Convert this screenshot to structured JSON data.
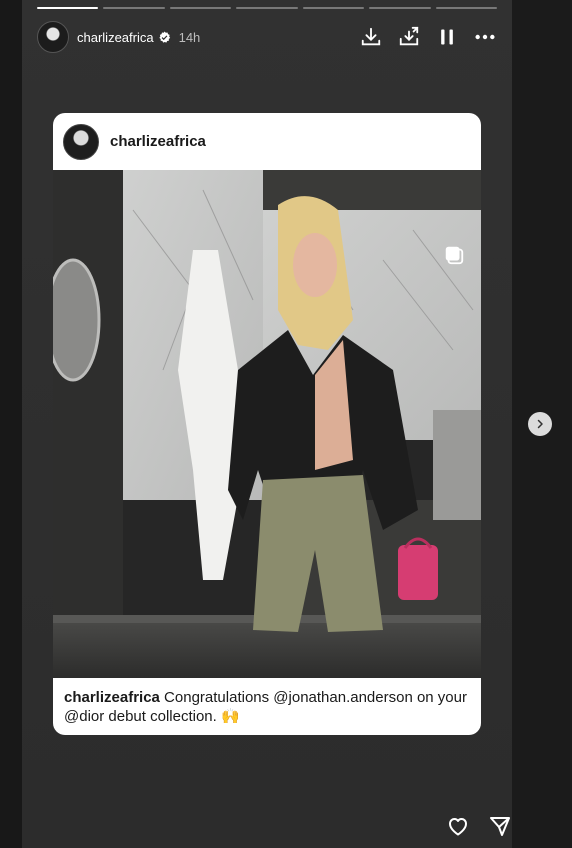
{
  "story": {
    "progress_segments": 7,
    "active_segment": 0,
    "header": {
      "username": "charlizeafrica",
      "verified": true,
      "timestamp": "14h"
    },
    "header_icons": [
      "download-icon",
      "save-to-device-icon",
      "pause-icon",
      "more-options-icon"
    ]
  },
  "card": {
    "username": "charlizeafrica",
    "caption_user": "charlizeafrica",
    "caption_text": " Congratulations @jonathan.anderson on your @dior debut collection. 🙌"
  },
  "navigation": {
    "next_icon": "chevron-right-icon"
  },
  "footer_icons": [
    "heart-icon",
    "send-icon"
  ]
}
